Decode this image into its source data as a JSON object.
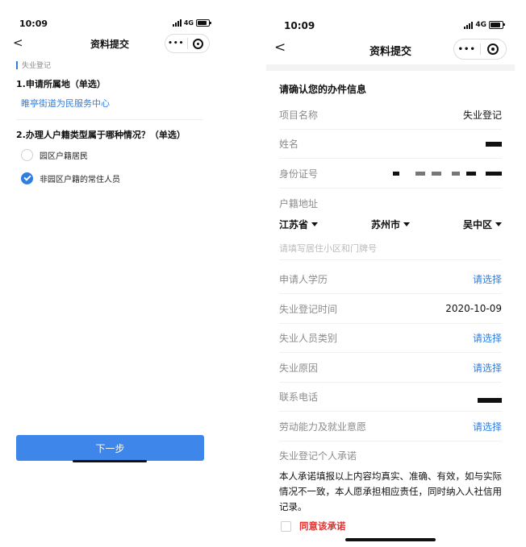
{
  "left": {
    "status": {
      "time": "10:09",
      "network": "4G"
    },
    "nav": {
      "title": "资料提交",
      "back": "<",
      "more": "•••"
    },
    "section_tag": "失业登记",
    "q1": {
      "title": "1.申请所属地（单选）",
      "answer": "睢亭街道为民服务中心"
    },
    "q2": {
      "title": "2.办理人户籍类型属于哪种情况？（单选）",
      "options": [
        {
          "label": "园区户籍居民",
          "checked": false
        },
        {
          "label": "非园区户籍的常住人员",
          "checked": true
        }
      ]
    },
    "next_button": "下一步"
  },
  "right": {
    "status": {
      "time": "10:09",
      "network": "4G"
    },
    "nav": {
      "title": "资料提交",
      "back": "<",
      "more": "•••"
    },
    "heading": "请确认您的办件信息",
    "rows": [
      {
        "label": "项目名称",
        "value": "失业登记"
      },
      {
        "label": "姓名",
        "value": ""
      },
      {
        "label": "身份证号",
        "value": ""
      }
    ],
    "address": {
      "label": "户籍地址",
      "province": "江苏省",
      "city": "苏州市",
      "district": "吴中区",
      "placeholder": "请填写居住小区和门牌号"
    },
    "rows2": [
      {
        "label": "申请人学历",
        "value": "请选择"
      },
      {
        "label": "失业登记时间",
        "value": "2020-10-09"
      },
      {
        "label": "失业人员类别",
        "value": "请选择"
      },
      {
        "label": "失业原因",
        "value": "请选择"
      },
      {
        "label": "联系电话",
        "value": ""
      },
      {
        "label": "劳动能力及就业意愿",
        "value": "请选择"
      }
    ],
    "promise": {
      "title": "失业登记个人承诺",
      "text": "本人承诺填报以上内容均真实、准确、有效，如与实际情况不一致，本人愿承担相应责任，同时纳入人社信用记录。",
      "agree": "同意该承诺"
    }
  },
  "colors": {
    "accent": "#2f7de1",
    "button": "#3f86ea",
    "warning": "#e0322f"
  },
  "icons": {
    "back": "chevron-left-icon",
    "more": "more-dots-icon",
    "close": "target-circle-icon",
    "signal": "signal-icon",
    "battery": "battery-icon"
  }
}
